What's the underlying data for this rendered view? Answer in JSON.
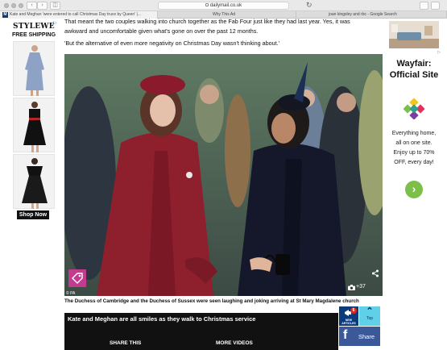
{
  "browser": {
    "url": "dailymail.co.uk",
    "tabs": [
      {
        "label": "Kate and Meghan 'were entered to call Christmas Day truce by Queen' |...",
        "favicon": "M",
        "active": true
      },
      {
        "label": "Why This Ad",
        "favicon": "",
        "active": false
      },
      {
        "label": "joan kingsley and rbc - Google Search",
        "favicon": "G",
        "active": false
      }
    ]
  },
  "left_ad": {
    "brand": "STYLEWE",
    "tagline": "FREE SHIPPING",
    "cta": "Shop Now",
    "adchoices_icon": "adchoices-icon"
  },
  "right_ad": {
    "brand": "Wayfair: Official Site",
    "copy_lines": [
      "Everything home,",
      "all on one site.",
      "Enjoy up to 70%",
      "OFF, every day!"
    ],
    "cta_icon": "chevron-right-icon",
    "accent": "#7cc04a"
  },
  "article": {
    "para1_line1": "That meant the two couples walking into church together as the Fab Four just like they had last year. Yes, it was",
    "para1_line2": "awkward and uncomfortable given what's gone on over the past 12 months.",
    "para2": "'But the alternative of even more negativity on Christmas Day wasn't thinking about.'",
    "photo_credit": "© PA",
    "gallery_count": "+37",
    "caption": "The Duchess of Cambridge and the Duchess of Sussex were seen laughing and joking arriving at St Mary Magdalene church"
  },
  "video": {
    "title": "Kate and Meghan are all smiles as they walk to Christmas service",
    "share_label": "SHARE THIS",
    "more_label": "MORE VIDEOS"
  },
  "floating": {
    "new_articles_count": "6",
    "new_articles_label_1": "NEW",
    "new_articles_label_2": "ARTICLES",
    "top_label": "Top",
    "share_label": "Share"
  },
  "colors": {
    "dm_blue": "#0c3b7c",
    "facebook": "#3b5998",
    "top_cyan": "#5fd0e7",
    "pa_magenta": "#c23b8f"
  }
}
